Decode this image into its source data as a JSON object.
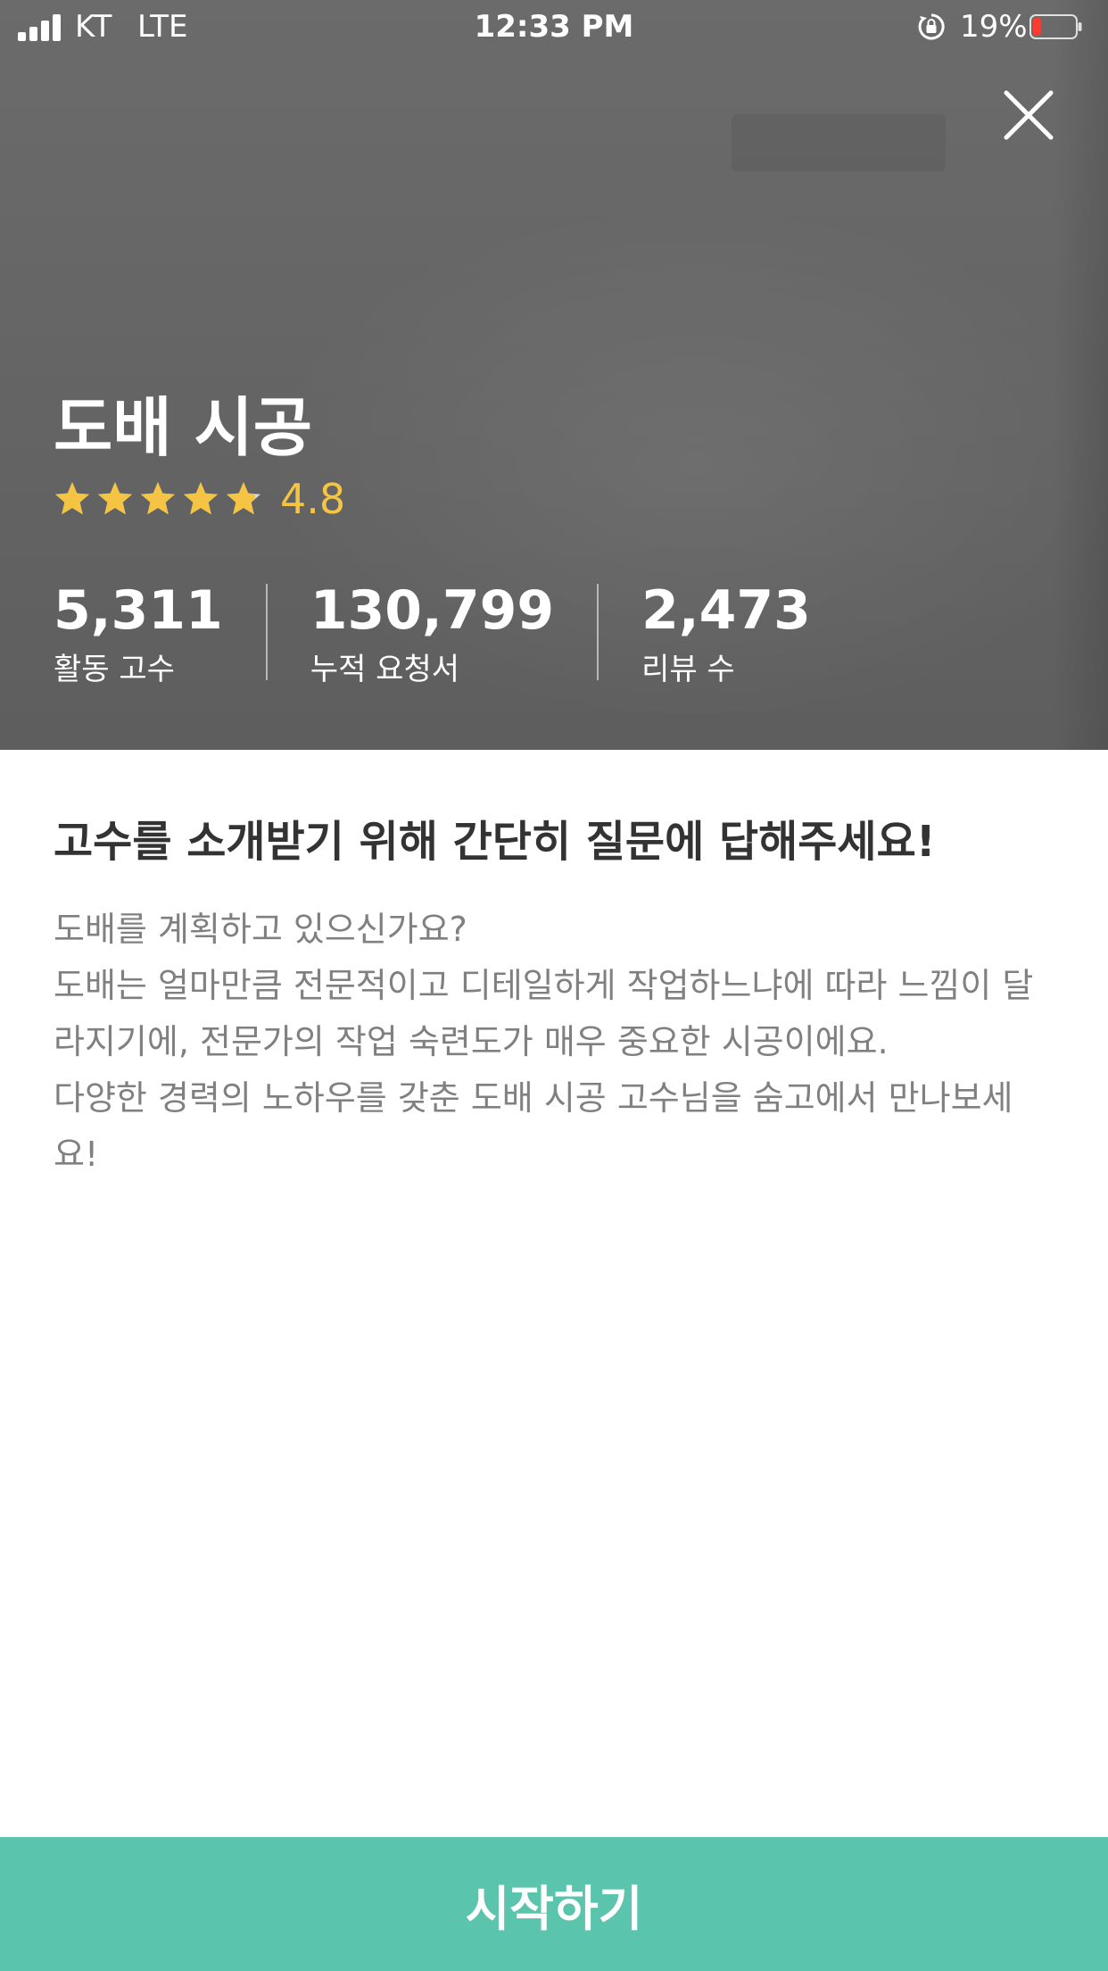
{
  "status_bar": {
    "carrier": "KT",
    "network": "LTE",
    "time": "12:33 PM",
    "battery_percent": "19%",
    "battery_level": 0.19,
    "icons": [
      "signal-icon",
      "rotation-lock-icon",
      "battery-icon"
    ]
  },
  "header": {
    "close_icon": "close-icon"
  },
  "service": {
    "title": "도배 시공",
    "rating": "4.8",
    "rating_value": 4.8,
    "rating_max": 5,
    "star_color": "#f6c443"
  },
  "stats": [
    {
      "value": "5,311",
      "label": "활동 고수"
    },
    {
      "value": "130,799",
      "label": "누적 요청서"
    },
    {
      "value": "2,473",
      "label": "리뷰 수"
    }
  ],
  "main": {
    "question_title": "고수를 소개받기 위해 간단히 질문에 답해주세요!",
    "description_lines": [
      "도배를 계획하고 있으신가요?",
      "도배는 얼마만큼 전문적이고 디테일하게 작업하느냐에 따라 느낌이 달라지기에, 전문가의 작업 숙련도가 매우 중요한 시공이에요.",
      "다양한 경력의 노하우를 갖춘 도배 시공 고수님을 숨고에서 만나보세요!"
    ]
  },
  "footer": {
    "start_label": "시작하기",
    "accent_color": "#5bc4ad"
  }
}
